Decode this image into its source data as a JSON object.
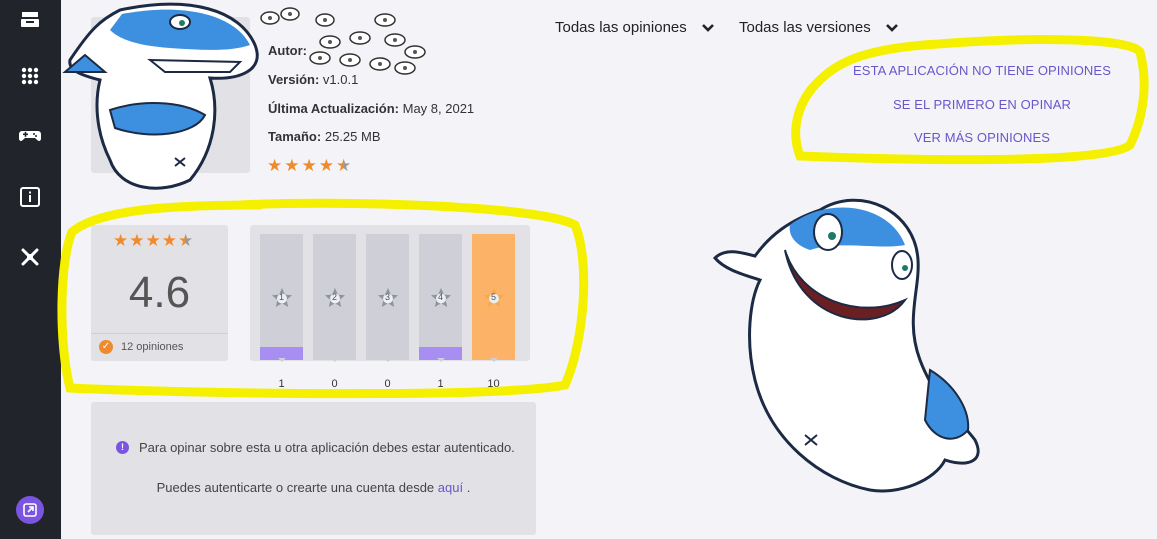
{
  "sidebar": {
    "items": [
      {
        "icon": "inbox-tray-icon"
      },
      {
        "icon": "apps-grid-icon"
      },
      {
        "icon": "gamepad-icon"
      },
      {
        "icon": "info-icon"
      },
      {
        "icon": "settings-cross-icon"
      }
    ],
    "bottom_icon": "external-link-icon",
    "accent": "#7b55e0"
  },
  "app_info": {
    "author_label": "Autor:",
    "author_value": "",
    "version_label": "Versión:",
    "version_value": "v1.0.1",
    "updated_label": "Última Actualización:",
    "updated_value": "May 8, 2021",
    "size_label": "Tamaño:",
    "size_value": "25.25 MB",
    "stars": 4.5
  },
  "filters": {
    "opinions": "Todas las opiniones",
    "versions": "Todas las versiones"
  },
  "notices": {
    "no_opinions": "ESTA APLICACIÓN NO TIENE OPINIONES",
    "be_first": "SE EL PRIMERO EN OPINAR",
    "see_more": "VER MÁS OPINIONES"
  },
  "rating": {
    "value": "4.6",
    "count_text": "12 opiniones",
    "stars": 4.5
  },
  "distribution": {
    "bars": [
      {
        "star": "1",
        "count": "1",
        "fraction": 0.1
      },
      {
        "star": "2",
        "count": "0",
        "fraction": 0
      },
      {
        "star": "3",
        "count": "0",
        "fraction": 0
      },
      {
        "star": "4",
        "count": "1",
        "fraction": 0.1
      },
      {
        "star": "5",
        "count": "10",
        "fraction": 1.0
      }
    ]
  },
  "auth": {
    "message": "Para opinar sobre esta u otra aplicación debes estar autenticado.",
    "prefix": "Puedes autenticarte o crearte una cuenta desde",
    "link": "aquí",
    "suffix": "."
  },
  "colors": {
    "annotation": "#f5f000",
    "star": "#ef8b2c",
    "link": "#6a56c9",
    "bar_fill": "#a88ef2",
    "bar_active": "#fcb368"
  }
}
